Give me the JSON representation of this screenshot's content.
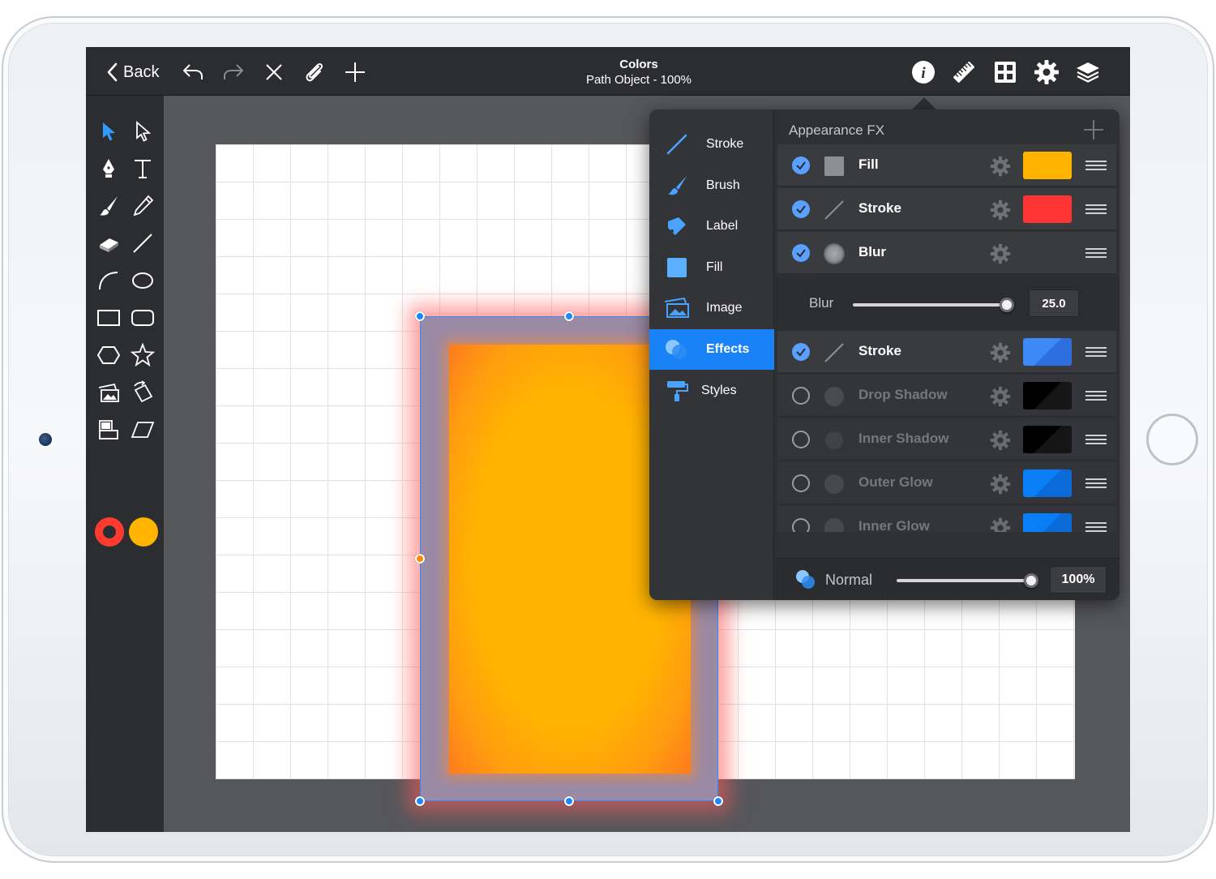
{
  "topbar": {
    "back_label": "Back",
    "title": "Colors",
    "subtitle": "Path Object - 100%"
  },
  "popover": {
    "sidebar": [
      {
        "label": "Stroke",
        "icon": "stroke-line-icon"
      },
      {
        "label": "Brush",
        "icon": "brush-icon"
      },
      {
        "label": "Label",
        "icon": "label-tag-icon"
      },
      {
        "label": "Fill",
        "icon": "fill-square-icon"
      },
      {
        "label": "Image",
        "icon": "image-icon"
      },
      {
        "label": "Effects",
        "icon": "effects-circles-icon",
        "active": true
      },
      {
        "label": "Styles",
        "icon": "paint-roller-icon"
      }
    ],
    "header": "Appearance FX",
    "fx_rows": [
      {
        "label": "Fill",
        "enabled": true,
        "swatch": "#ffb400"
      },
      {
        "label": "Stroke",
        "enabled": true,
        "swatch": "#ff3434"
      },
      {
        "label": "Blur",
        "enabled": true,
        "swatch": ""
      },
      {
        "label": "Stroke",
        "enabled": true,
        "swatch": "#2f7cf6"
      },
      {
        "label": "Drop Shadow",
        "enabled": false,
        "swatch": "#000000"
      },
      {
        "label": "Inner Shadow",
        "enabled": false,
        "swatch": "#000000"
      },
      {
        "label": "Outer Glow",
        "enabled": false,
        "swatch": "#0a7ef7"
      },
      {
        "label": "Inner Glow",
        "enabled": false,
        "swatch": "#0a7ef7"
      }
    ],
    "blur": {
      "label": "Blur",
      "value": "25.0",
      "fraction": 1.0
    },
    "footer": {
      "blend_mode": "Normal",
      "opacity": "100%",
      "opacity_fraction": 1.0
    }
  },
  "colors": {
    "accent": "#1a82f7",
    "stroke_color": "#ff3b30",
    "fill_color": "#ffb400"
  }
}
